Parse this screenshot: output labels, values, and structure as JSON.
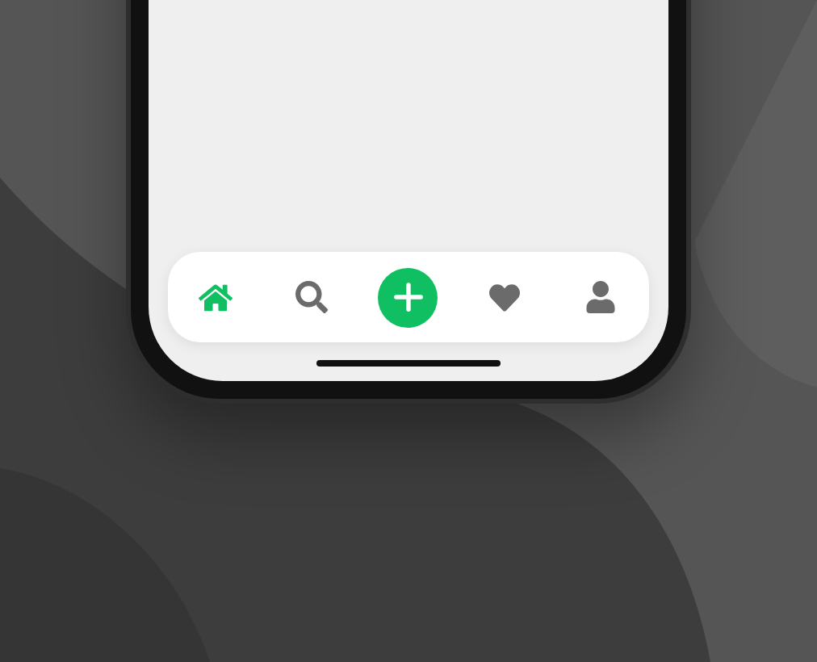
{
  "tab_bar": {
    "items": [
      {
        "kind": "home",
        "selected": true
      },
      {
        "kind": "search",
        "selected": false
      },
      {
        "kind": "add",
        "selected": false
      },
      {
        "kind": "favorites",
        "selected": false
      },
      {
        "kind": "profile",
        "selected": false
      }
    ]
  }
}
